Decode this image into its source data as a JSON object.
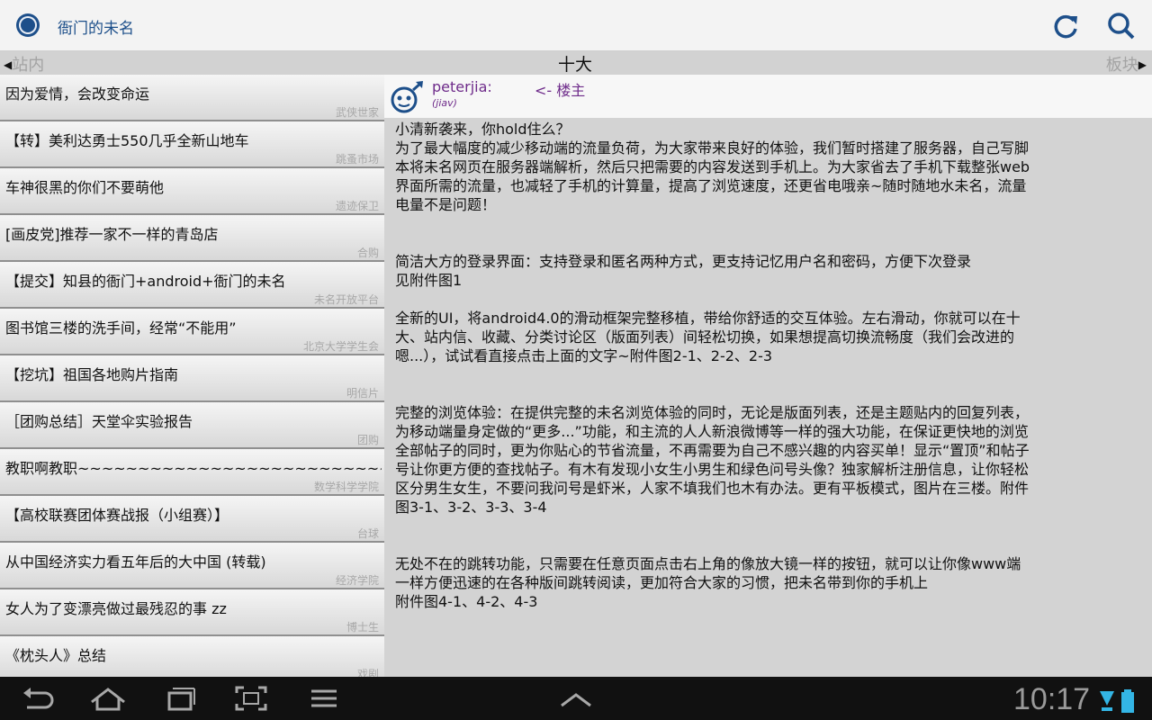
{
  "actionbar": {
    "title": "衙门的未名",
    "icons": {
      "app": "app-logo-icon",
      "refresh": "refresh-icon",
      "search": "search-icon"
    }
  },
  "subbar": {
    "left_label": "站内",
    "center_label": "十大",
    "right_label": "板块"
  },
  "topics": [
    {
      "title": "因为爱情，会改变命运",
      "board": "武侠世家"
    },
    {
      "title": "【转】美利达勇士550几乎全新山地车",
      "board": "跳蚤市场"
    },
    {
      "title": "车神很黑的你们不要萌他",
      "board": "遗迹保卫"
    },
    {
      "title": "[画皮党]推荐一家不一样的青岛店",
      "board": "合购"
    },
    {
      "title": "【提交】知县的衙门+android+衙门的未名",
      "board": "未名开放平台"
    },
    {
      "title": "图书馆三楼的洗手间，经常“不能用”",
      "board": "北京大学学生会"
    },
    {
      "title": "【挖坑】祖国各地购片指南",
      "board": "明信片"
    },
    {
      "title": "［团购总结］天堂伞实验报告",
      "board": "团购"
    },
    {
      "title": "教职啊教职~~~~~~~~~~~~~~~~~~~~~~~~~~~~~~~~~~~",
      "board": "数学科学学院"
    },
    {
      "title": "【高校联赛团体赛战报（小组赛）】",
      "board": "台球"
    },
    {
      "title": "从中国经济实力看五年后的大中国 (转载)",
      "board": "经济学院"
    },
    {
      "title": "女人为了变漂亮做过最残忍的事 zz",
      "board": "博士生"
    },
    {
      "title": "《枕头人》总结",
      "board": "戏剧"
    }
  ],
  "post": {
    "author": "peterjia:",
    "author_tag": "<- 楼主",
    "author_nick": "(jiav)",
    "body": "小清新袭来，你hold住么？\n为了最大幅度的减少移动端的流量负荷，为大家带来良好的体验，我们暂时搭建了服务器，自己写脚本将未名网页在服务器端解析，然后只把需要的内容发送到手机上。为大家省去了手机下载整张web界面所需的流量，也减轻了手机的计算量，提高了浏览速度，还更省电哦亲~随时随地水未名，流量电量不是问题！\n\n\n简洁大方的登录界面：支持登录和匿名两种方式，更支持记忆用户名和密码，方便下次登录\n见附件图1\n\n全新的UI，将android4.0的滑动框架完整移植，带给你舒适的交互体验。左右滑动，你就可以在十大、站内信、收藏、分类讨论区（版面列表）间轻松切换，如果想提高切换流畅度（我们会改进的嗯...），试试看直接点击上面的文字~附件图2-1、2-2、2-3\n\n\n完整的浏览体验：在提供完整的未名浏览体验的同时，无论是版面列表，还是主题贴内的回复列表，为移动端量身定做的“更多...”功能，和主流的人人新浪微博等一样的强大功能，在保证更快地的浏览全部帖子的同时，更为你贴心的节省流量，不再需要为自己不感兴趣的内容买单！显示“置顶”和帖子号让你更方便的查找帖子。有木有发现小女生小男生和绿色问号头像？独家解析注册信息，让你轻松区分男生女生，不要问我问号是虾米，人家不填我们也木有办法。更有平板模式，图片在三楼。附件图3-1、3-2、3-3、3-4\n\n\n无处不在的跳转功能，只需要在任意页面点击右上角的像放大镜一样的按钮，就可以让你像www端一样方便迅速的在各种版间跳转阅读，更加符合大家的习惯，把未名带到你的手机上\n附件图4-1、4-2、4-3"
  },
  "navbar": {
    "time": "10:17",
    "buttons": [
      "back-icon",
      "home-icon",
      "recent-apps-icon",
      "screenshot-icon",
      "menu-icon",
      "expand-up-icon"
    ]
  },
  "colors": {
    "title_blue": "#1d4f8a",
    "author_purple": "#6e2b8a"
  }
}
